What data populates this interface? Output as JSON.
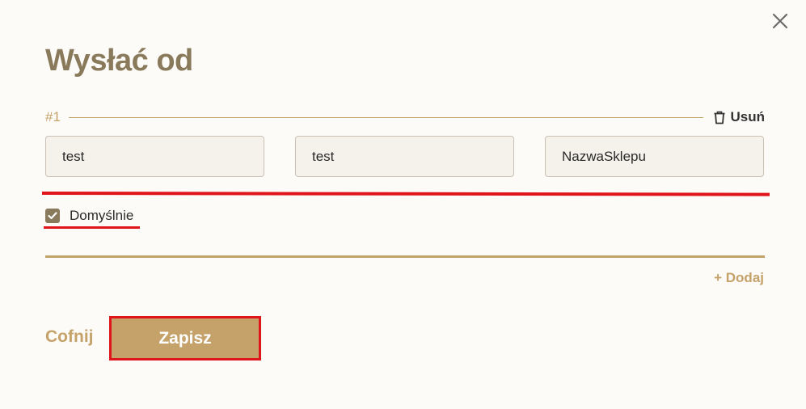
{
  "modal": {
    "title": "Wysłać od"
  },
  "entry": {
    "number": "#1",
    "remove_label": "Usuń",
    "fields": [
      "test",
      "test",
      "NazwaSklepu"
    ],
    "default_label": "Domyślnie",
    "default_checked": true
  },
  "actions": {
    "add_label": "+ Dodaj",
    "cancel_label": "Cofnij",
    "save_label": "Zapisz"
  },
  "icons": {
    "close": "close-icon",
    "remove": "trash-icon",
    "checkbox": "checkmark-icon"
  },
  "colors": {
    "accent": "#c4a26a",
    "title": "#8a7a5c",
    "highlight": "#e0141b",
    "field_bg": "#f5f2ec"
  }
}
